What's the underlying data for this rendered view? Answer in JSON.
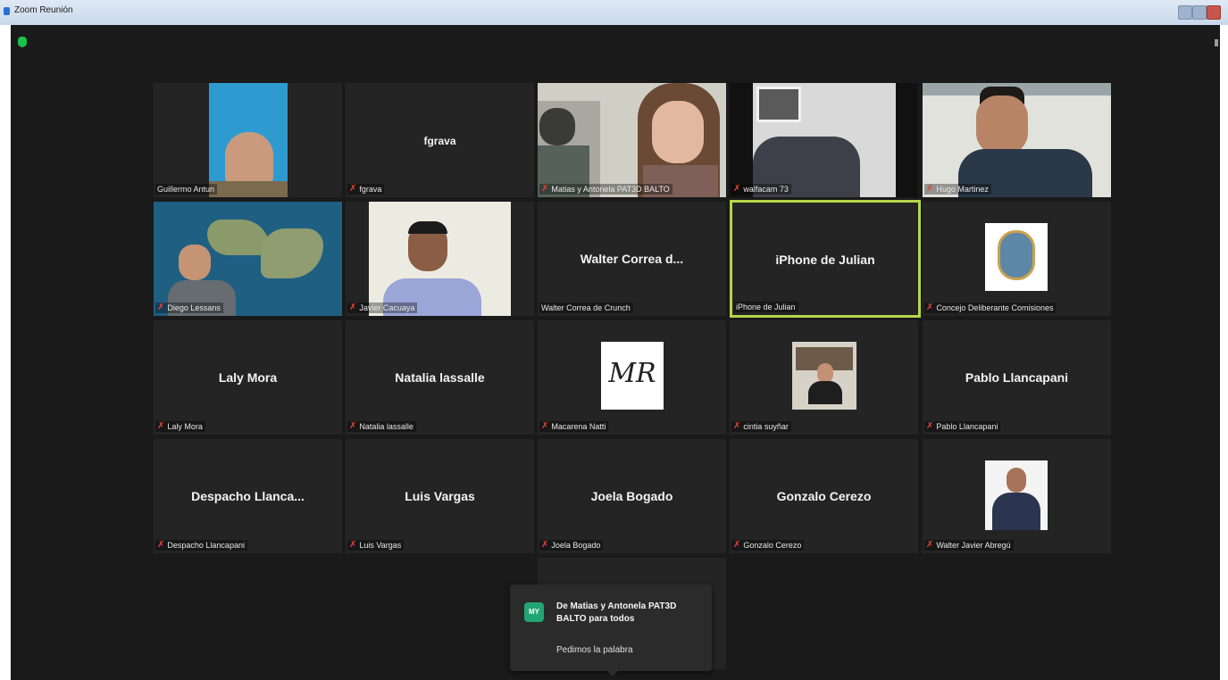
{
  "window": {
    "title": "Zoom Reunión"
  },
  "participants": [
    {
      "name": "Guillermo Antun",
      "muted": false,
      "video": true
    },
    {
      "name": "fgrava",
      "display": "fgrava",
      "muted": true,
      "video": false
    },
    {
      "name": "Matias y Antonela PAT3D BALTO",
      "muted": true,
      "video": true
    },
    {
      "name": "walfacam 73",
      "muted": true,
      "video": true
    },
    {
      "name": "Hugo Martinez",
      "muted": true,
      "video": true
    },
    {
      "name": "Diego Lessans",
      "muted": true,
      "video": true
    },
    {
      "name": "Javier Cacuaya",
      "muted": true,
      "video": true
    },
    {
      "name": "Walter Correa de Crunch",
      "display": "Walter Correa d...",
      "muted": false,
      "video": false
    },
    {
      "name": "iPhone de Julian",
      "display": "iPhone de Julian",
      "muted": false,
      "video": false,
      "active_speaker": true
    },
    {
      "name": "Concejo Deliberante Comisiones",
      "muted": true,
      "video": false
    },
    {
      "name": "Laly Mora",
      "display": "Laly Mora",
      "muted": true,
      "video": false
    },
    {
      "name": "Natalia lassalle",
      "display": "Natalia lassalle",
      "muted": true,
      "video": false
    },
    {
      "name": "Macarena Natti",
      "avatar_text": "MR",
      "muted": true,
      "video": false
    },
    {
      "name": "cintia suyñar",
      "muted": true,
      "video": false
    },
    {
      "name": "Pablo Llancapani",
      "display": "Pablo Llancapani",
      "muted": true,
      "video": false
    },
    {
      "name": "Despacho Llancapani",
      "display": "Despacho  Llanca...",
      "muted": true,
      "video": false
    },
    {
      "name": "Luis Vargas",
      "display": "Luis Vargas",
      "muted": true,
      "video": false
    },
    {
      "name": "Joela Bogado",
      "display": "Joela Bogado",
      "muted": true,
      "video": false
    },
    {
      "name": "Gonzalo Cerezo",
      "display": "Gonzalo Cerezo",
      "muted": true,
      "video": false
    },
    {
      "name": "Walter Javier Abregú",
      "muted": true,
      "video": false
    }
  ],
  "chat_notification": {
    "avatar": "MY",
    "title": "De Matias y Antonela PAT3D BALTO para todos",
    "message": "Pedimos la palabra"
  },
  "colors": {
    "background": "#1a1a1a",
    "tile": "#242424",
    "active_speaker_border": "#b5d648",
    "muted_icon": "#e0433b",
    "security_shield": "#19c24b"
  },
  "icons": [
    "security-shield-icon",
    "muted-mic-icon",
    "more-options-icon"
  ]
}
